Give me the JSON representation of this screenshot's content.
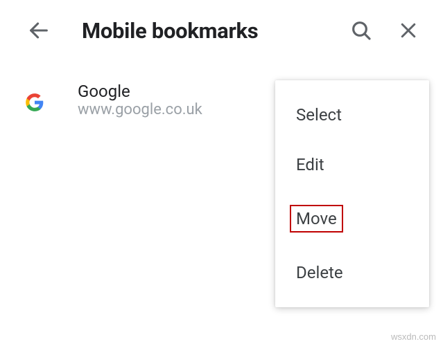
{
  "header": {
    "title": "Mobile bookmarks"
  },
  "bookmark": {
    "title": "Google",
    "url": "www.google.co.uk"
  },
  "menu": {
    "select": "Select",
    "edit": "Edit",
    "move": "Move",
    "delete": "Delete"
  },
  "watermark": "wsxdn.com"
}
